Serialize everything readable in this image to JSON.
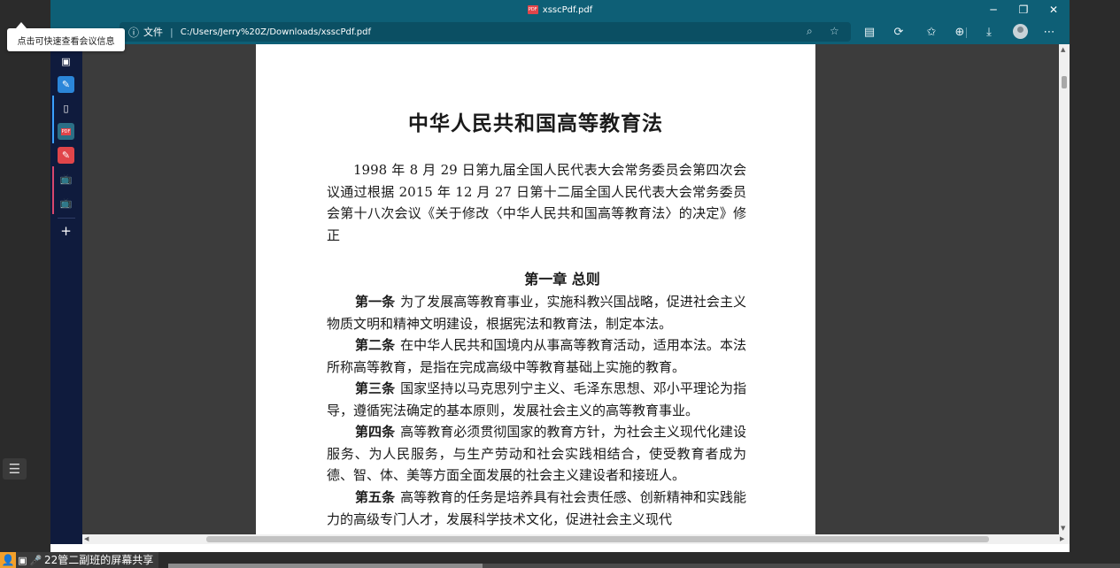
{
  "meeting": {
    "tooltip": "点击可快速查看会议信息",
    "share_label": "22管二副班的屏幕共享",
    "share_progress": 0.33
  },
  "browser": {
    "window_title": "xsscPdf.pdf",
    "address": {
      "scheme_label": "文件",
      "url": "C:/Users/Jerry%20Z/Downloads/xsscPdf.pdf"
    }
  },
  "pdf": {
    "title": "中华人民共和国高等教育法",
    "preamble": "1998 年 8 月 29 日第九届全国人民代表大会常务委员会第四次会议通过根据 2015 年 12 月 27 日第十二届全国人民代表大会常务委员会第十八次会议《关于修改〈中华人民共和国高等教育法〉的决定》修正",
    "chapter": "第一章  总则",
    "articles": [
      {
        "head": "第一条",
        "text": "为了发展高等教育事业，实施科教兴国战略，促进社会主义物质文明和精神文明建设，根据宪法和教育法，制定本法。"
      },
      {
        "head": "第二条",
        "text": "在中华人民共和国境内从事高等教育活动，适用本法。本法所称高等教育，是指在完成高级中等教育基础上实施的教育。"
      },
      {
        "head": "第三条",
        "text": "国家坚持以马克思列宁主义、毛泽东思想、邓小平理论为指导，遵循宪法确定的基本原则，发展社会主义的高等教育事业。"
      },
      {
        "head": "第四条",
        "text": "高等教育必须贯彻国家的教育方针，为社会主义现代化建设服务、为人民服务，与生产劳动和社会实践相结合，使受教育者成为德、智、体、美等方面全面发展的社会主义建设者和接班人。"
      },
      {
        "head": "第五条",
        "text": "高等教育的任务是培养具有社会责任感、创新精神和实践能力的高级专门人才，发展科学技术文化，促进社会主义现代"
      }
    ]
  },
  "colors": {
    "title_bar": "#0e5f76",
    "edge_sidebar": "#0f1b3d",
    "viewer_bg": "#3c3c3c",
    "meeting_frame": "#2b2b2b"
  }
}
